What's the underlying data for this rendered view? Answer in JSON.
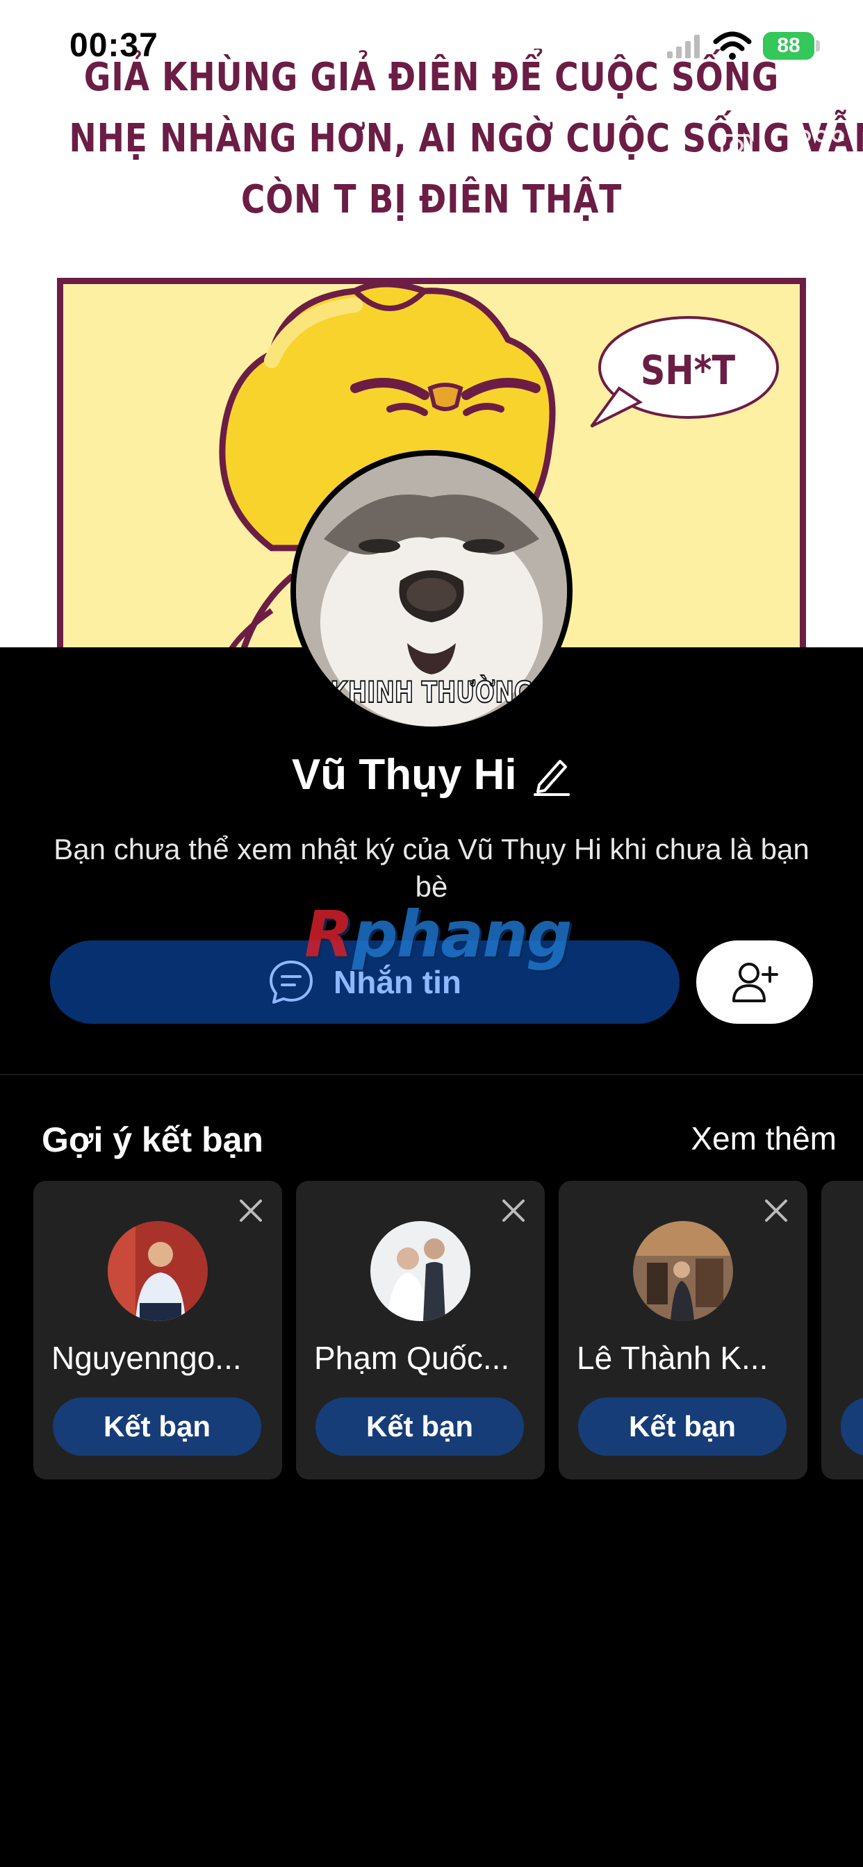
{
  "status_bar": {
    "time": "00:37",
    "battery": "88"
  },
  "cover": {
    "caption_lines": [
      "GIẢ KHÙNG GIẢ ĐIÊN ĐỂ CUỘC SỐNG",
      "NHẸ NHÀNG HƠN, AI NGỜ CUỘC SỐNG VẪN THẾ",
      "CÒN T BỊ ĐIÊN THẬT"
    ],
    "speech_bubble": "SH*T"
  },
  "profile": {
    "avatar_caption": "KHINH THƯỜNG",
    "name": "Vũ Thụy Hi",
    "privacy_note": "Bạn chưa thể xem nhật ký của Vũ Thụy Hi khi chưa là bạn bè",
    "message_label": "Nhắn tin",
    "watermark": {
      "r": "R",
      "rest": "phang"
    }
  },
  "suggestions": {
    "title": "Gợi ý kết bạn",
    "see_more": "Xem thêm",
    "cards": [
      {
        "name": "Nguyenngo...",
        "button": "Kết bạn"
      },
      {
        "name": "Phạm Quốc...",
        "button": "Kết bạn"
      },
      {
        "name": "Lê Thành K...",
        "button": "Kết bạn"
      }
    ]
  },
  "colors": {
    "accent_blue": "#06306f",
    "card_bg": "#222222",
    "comic_ink": "#6b1d45",
    "battery_green": "#34c759"
  },
  "icons": [
    "back-arrow-icon",
    "camera-icon",
    "more-icon",
    "edit-pencil-icon",
    "chat-bubble-icon",
    "add-friend-icon",
    "close-icon",
    "wifi-icon",
    "signal-icon"
  ]
}
